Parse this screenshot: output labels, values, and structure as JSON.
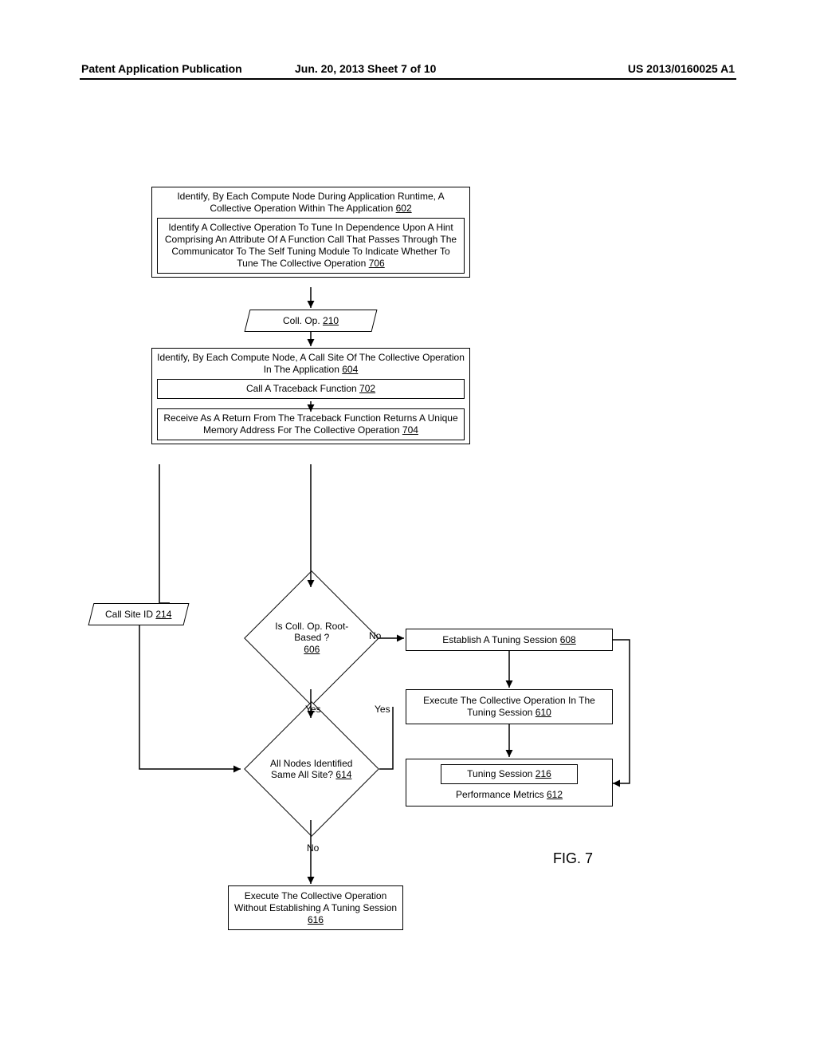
{
  "header": {
    "left": "Patent Application Publication",
    "center": "Jun. 20, 2013  Sheet 7 of 10",
    "right": "US 2013/0160025 A1"
  },
  "box602": {
    "title": "Identify, By Each Compute Node During Application Runtime, A Collective Operation Within The Application",
    "title_ref": "602",
    "inner": "Identify A Collective Operation To Tune In Dependence Upon A Hint Comprising An Attribute Of A Function Call That Passes Through The Communicator To The Self Tuning Module To Indicate Whether To Tune The Collective Operation",
    "inner_ref": "706"
  },
  "para210": {
    "text": "Coll. Op.",
    "ref": "210"
  },
  "box604": {
    "title": "Identify, By Each Compute Node, A Call Site Of The Collective Operation  In The Application",
    "title_ref": "604",
    "step1": "Call A Traceback Function",
    "step1_ref": "702",
    "step2": "Receive As A Return From The Traceback Function Returns A Unique Memory Address For The Collective Operation",
    "step2_ref": "704"
  },
  "para214": {
    "text": "Call Site ID",
    "ref": "214"
  },
  "dec606": {
    "text": "Is Coll. Op. Root-Based ?",
    "ref": "606"
  },
  "dec614": {
    "text": "All Nodes Identified Same All Site?",
    "ref": "614"
  },
  "box608": {
    "text": "Establish A Tuning Session",
    "ref": "608"
  },
  "box610": {
    "text": "Execute The Collective Operation In The Tuning Session",
    "ref": "610"
  },
  "box612": {
    "inner": "Tuning Session",
    "inner_ref": "216",
    "outer": "Performance Metrics",
    "outer_ref": "612"
  },
  "box616": {
    "text": "Execute The Collective Operation Without Establishing A Tuning Session",
    "ref": "616"
  },
  "labels": {
    "yes": "Yes",
    "no": "No"
  },
  "figure": "FIG. 7",
  "chart_data": {
    "type": "flowchart",
    "nodes": [
      {
        "id": "602",
        "type": "process",
        "text": "Identify, By Each Compute Node During Application Runtime, A Collective Operation Within The Application 602",
        "contains": [
          "706"
        ]
      },
      {
        "id": "706",
        "type": "process",
        "text": "Identify A Collective Operation To Tune In Dependence Upon A Hint Comprising An Attribute Of A Function Call That Passes Through The Communicator To The Self Tuning Module To Indicate Whether To Tune The Collective Operation 706"
      },
      {
        "id": "210",
        "type": "data",
        "text": "Coll. Op. 210"
      },
      {
        "id": "604",
        "type": "process",
        "text": "Identify, By Each Compute Node, A Call Site Of The Collective Operation In The Application 604",
        "contains": [
          "702",
          "704"
        ]
      },
      {
        "id": "702",
        "type": "process",
        "text": "Call A Traceback Function 702"
      },
      {
        "id": "704",
        "type": "process",
        "text": "Receive As A Return From The Traceback Function Returns A Unique Memory Address For The Collective Operation 704"
      },
      {
        "id": "214",
        "type": "data",
        "text": "Call Site ID 214"
      },
      {
        "id": "606",
        "type": "decision",
        "text": "Is Coll. Op. Root-Based ? 606"
      },
      {
        "id": "614",
        "type": "decision",
        "text": "All Nodes Identified Same All Site? 614"
      },
      {
        "id": "608",
        "type": "process",
        "text": "Establish A Tuning Session 608"
      },
      {
        "id": "610",
        "type": "process",
        "text": "Execute The Collective Operation In The Tuning Session 610"
      },
      {
        "id": "612",
        "type": "process",
        "text": "Performance Metrics 612",
        "contains": [
          "216"
        ]
      },
      {
        "id": "216",
        "type": "process",
        "text": "Tuning Session 216"
      },
      {
        "id": "616",
        "type": "process",
        "text": "Execute The Collective Operation Without Establishing A Tuning Session 616"
      }
    ],
    "edges": [
      {
        "from": "602",
        "to": "210"
      },
      {
        "from": "210",
        "to": "604"
      },
      {
        "from": "604",
        "to": "214"
      },
      {
        "from": "604",
        "to": "606"
      },
      {
        "from": "214",
        "to": "614"
      },
      {
        "from": "606",
        "to": "614",
        "label": "Yes"
      },
      {
        "from": "606",
        "to": "608",
        "label": "No"
      },
      {
        "from": "614",
        "to": "608",
        "label": "Yes"
      },
      {
        "from": "614",
        "to": "616",
        "label": "No"
      },
      {
        "from": "608",
        "to": "610"
      },
      {
        "from": "610",
        "to": "612"
      },
      {
        "from": "608",
        "to": "612"
      }
    ]
  }
}
